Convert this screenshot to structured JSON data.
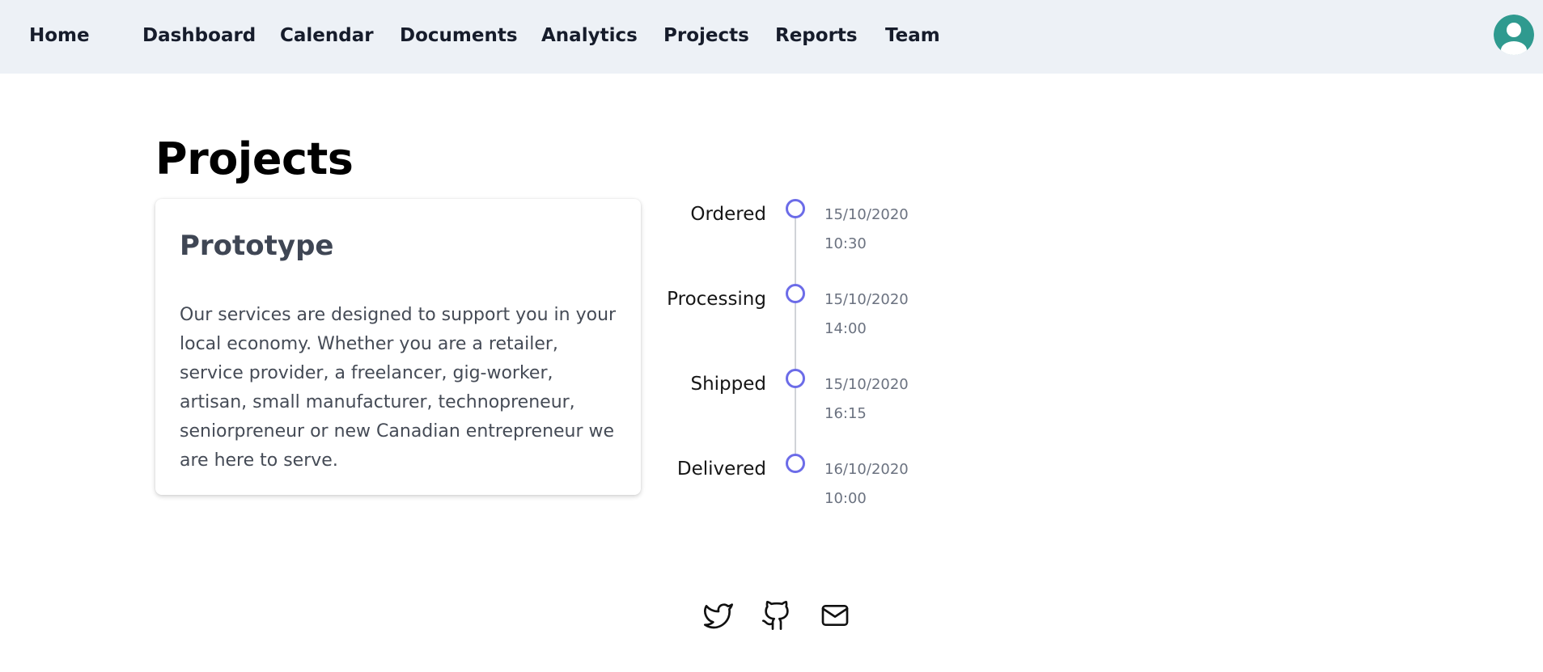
{
  "nav": {
    "items": [
      {
        "label": "Home"
      },
      {
        "label": "Dashboard"
      },
      {
        "label": "Calendar"
      },
      {
        "label": "Documents"
      },
      {
        "label": "Analytics"
      },
      {
        "label": "Projects"
      },
      {
        "label": "Reports"
      },
      {
        "label": "Team"
      }
    ],
    "avatar_icon": "user-avatar-icon"
  },
  "page": {
    "title": "Projects"
  },
  "card": {
    "title": "Prototype",
    "body": "Our services are designed to support you in your local economy. Whether you are a retailer, service provider, a freelancer, gig-worker, artisan, small manufacturer, technopreneur, seniorpreneur or new Canadian entrepreneur we are here to serve."
  },
  "timeline": {
    "steps": [
      {
        "label": "Ordered",
        "date": "15/10/2020",
        "time": "10:30"
      },
      {
        "label": "Processing",
        "date": "15/10/2020",
        "time": "14:00"
      },
      {
        "label": "Shipped",
        "date": "15/10/2020",
        "time": "16:15"
      },
      {
        "label": "Delivered",
        "date": "16/10/2020",
        "time": "10:00"
      }
    ]
  },
  "footer": {
    "icons": [
      "twitter-icon",
      "github-icon",
      "mail-icon"
    ]
  },
  "colors": {
    "nav_bg": "#edf1f6",
    "accent": "#6c6ce8",
    "avatar": "#2f9a8f"
  }
}
